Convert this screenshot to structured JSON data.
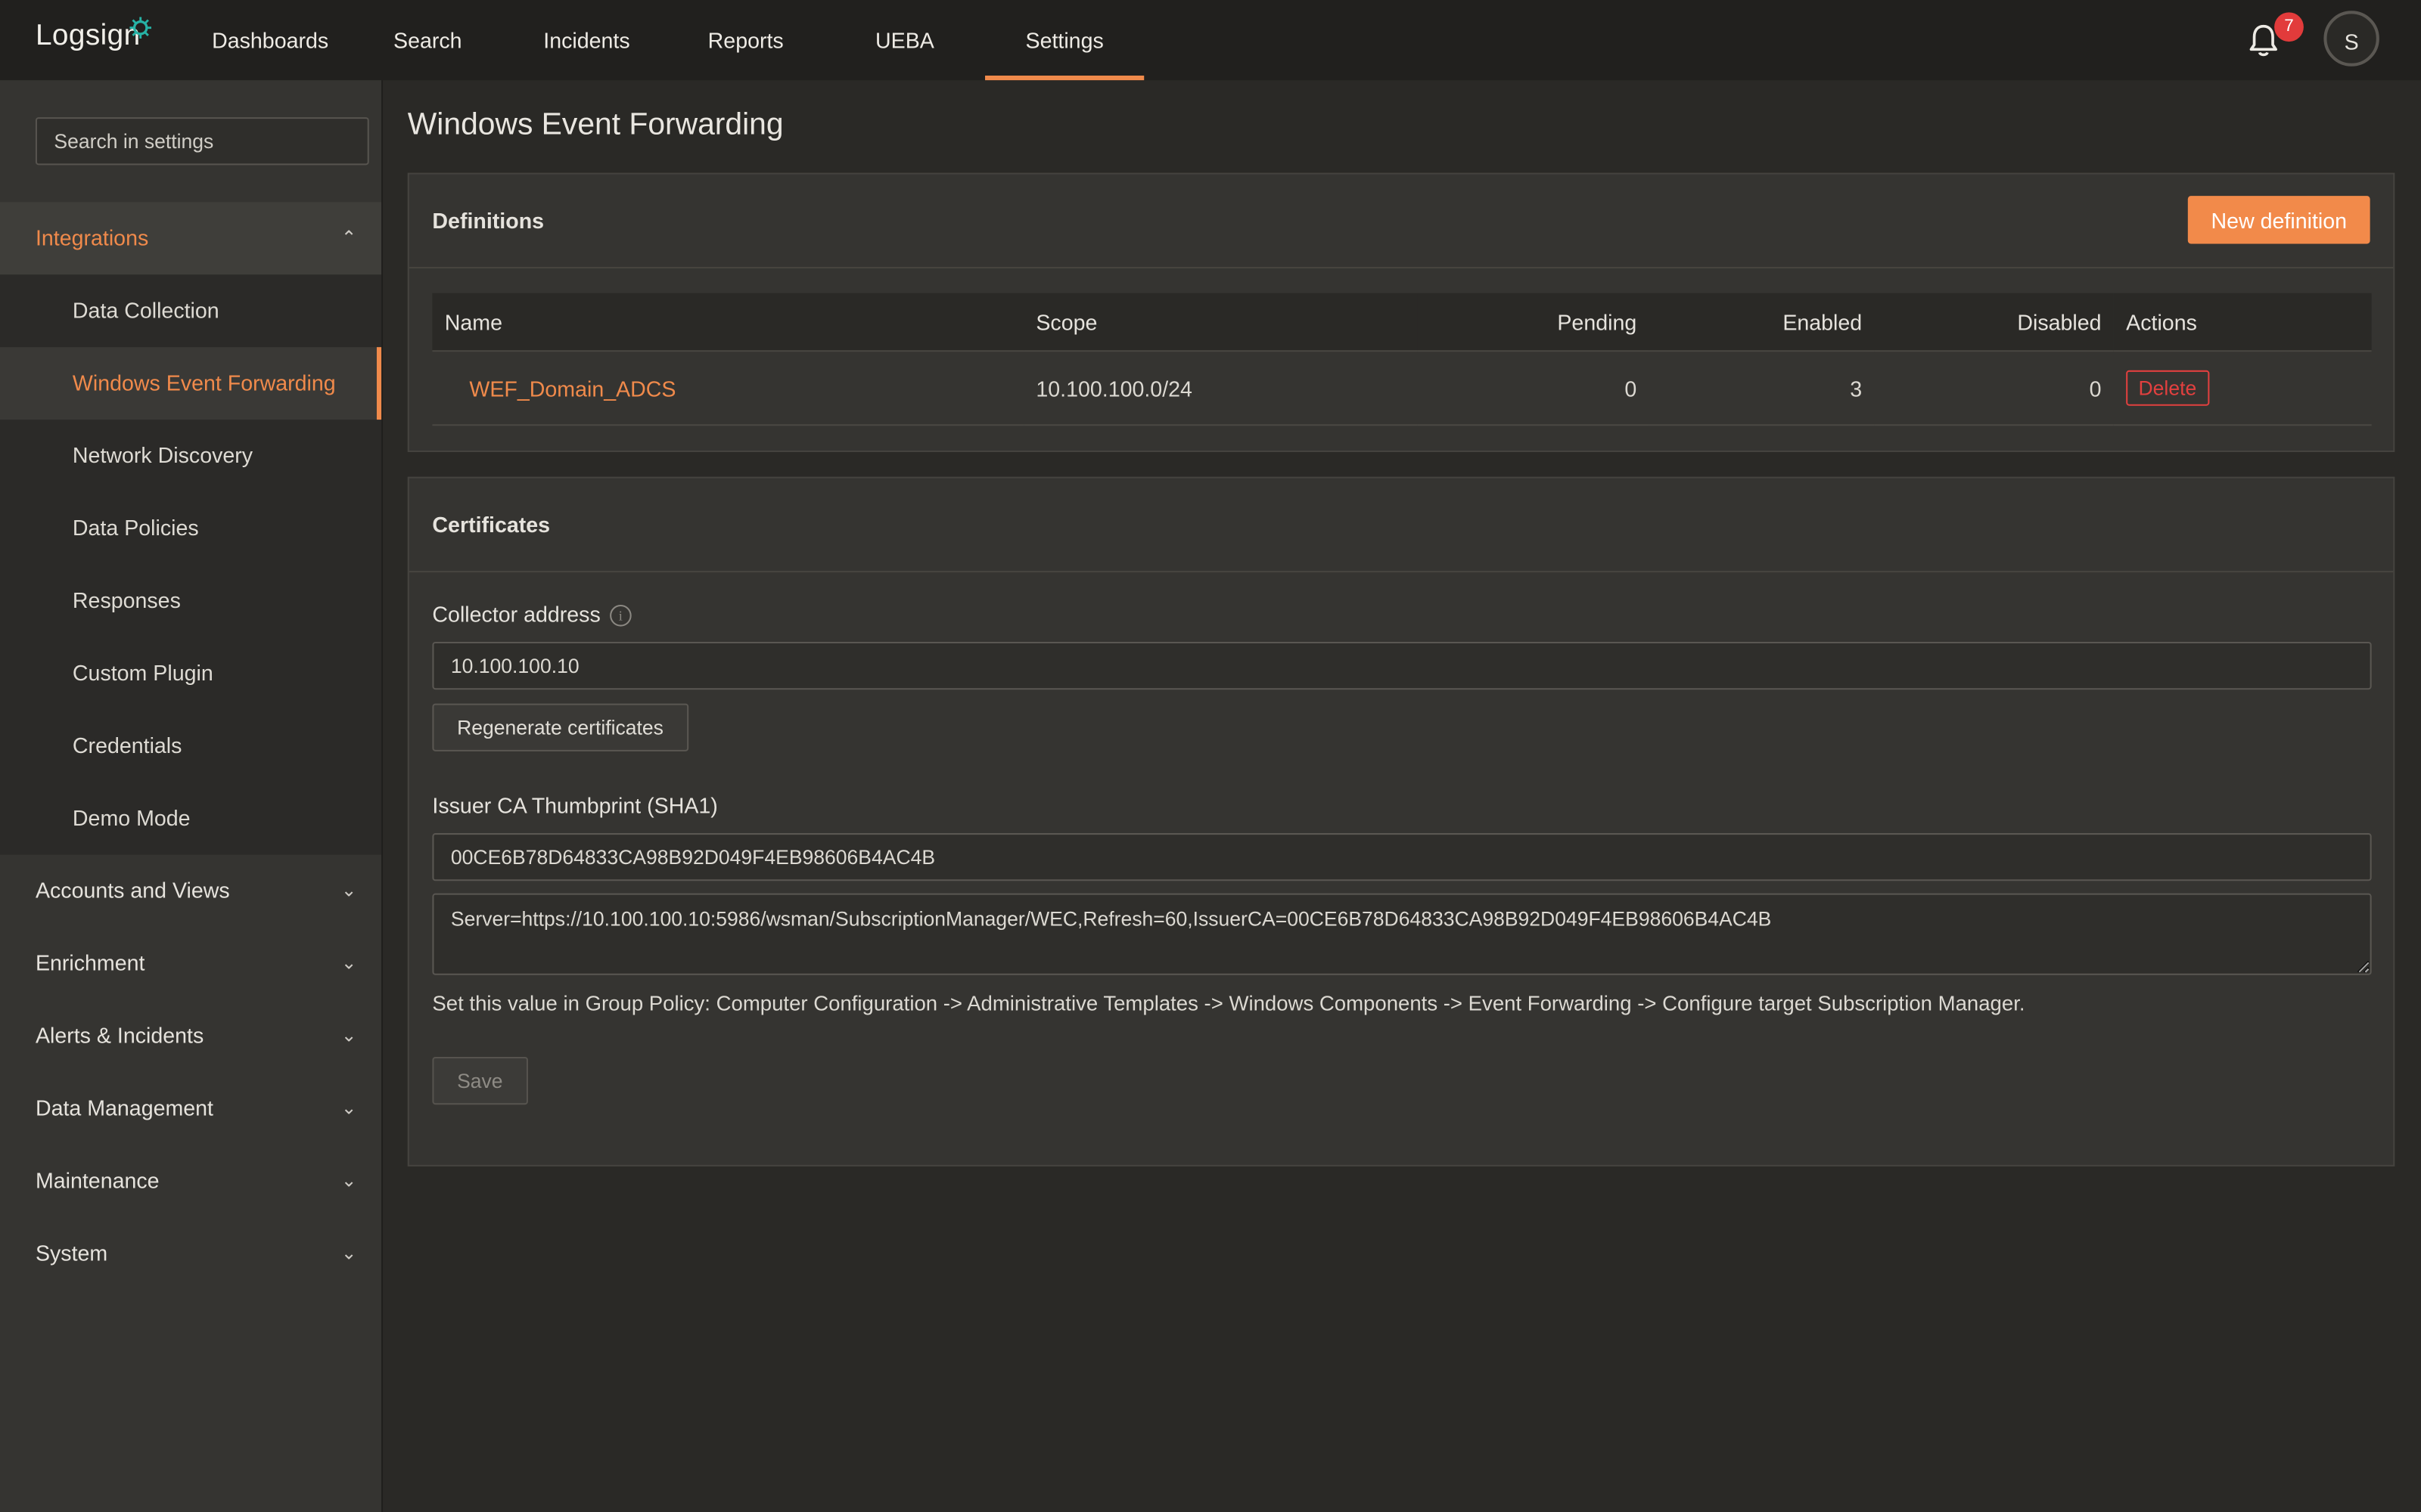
{
  "app": {
    "logo_text": "Logsign"
  },
  "nav": {
    "items": [
      {
        "label": "Dashboards"
      },
      {
        "label": "Search"
      },
      {
        "label": "Incidents"
      },
      {
        "label": "Reports"
      },
      {
        "label": "UEBA"
      },
      {
        "label": "Settings",
        "active": true
      }
    ],
    "notification_count": "7",
    "avatar_initial": "S"
  },
  "sidebar": {
    "search_placeholder": "Search in settings",
    "sections": [
      {
        "label": "Integrations",
        "expanded": true
      },
      {
        "label": "Accounts and Views"
      },
      {
        "label": "Enrichment"
      },
      {
        "label": "Alerts & Incidents"
      },
      {
        "label": "Data Management"
      },
      {
        "label": "Maintenance"
      },
      {
        "label": "System"
      }
    ],
    "integrations_items": [
      {
        "label": "Data Collection"
      },
      {
        "label": "Windows Event Forwarding",
        "active": true
      },
      {
        "label": "Network Discovery"
      },
      {
        "label": "Data Policies"
      },
      {
        "label": "Responses"
      },
      {
        "label": "Custom Plugin"
      },
      {
        "label": "Credentials"
      },
      {
        "label": "Demo Mode"
      }
    ]
  },
  "main": {
    "page_title": "Windows Event Forwarding",
    "definitions": {
      "title": "Definitions",
      "new_button": "New definition",
      "columns": {
        "name": "Name",
        "scope": "Scope",
        "pending": "Pending",
        "enabled": "Enabled",
        "disabled": "Disabled",
        "actions": "Actions"
      },
      "rows": [
        {
          "name": "WEF_Domain_ADCS",
          "scope": "10.100.100.0/24",
          "pending": "0",
          "enabled": "3",
          "disabled": "0",
          "action": "Delete"
        }
      ]
    },
    "certificates": {
      "title": "Certificates",
      "collector_label": "Collector address",
      "collector_value": "10.100.100.10",
      "regenerate_button": "Regenerate certificates",
      "thumbprint_label": "Issuer CA Thumbprint (SHA1)",
      "thumbprint_value": "00CE6B78D64833CA98B92D049F4EB98606B4AC4B",
      "subscription_value": "Server=https://10.100.100.10:5986/wsman/SubscriptionManager/WEC,Refresh=60,IssuerCA=00CE6B78D64833CA98B92D049F4EB98606B4AC4B",
      "hint": "Set this value in Group Policy: Computer Configuration -> Administrative Templates -> Windows Components -> Event Forwarding -> Configure target Subscription Manager.",
      "save_button": "Save"
    }
  },
  "colors": {
    "accent": "#f08a4b",
    "danger": "#e2403f",
    "background": "#2a2926",
    "topbar": "#21201e"
  }
}
